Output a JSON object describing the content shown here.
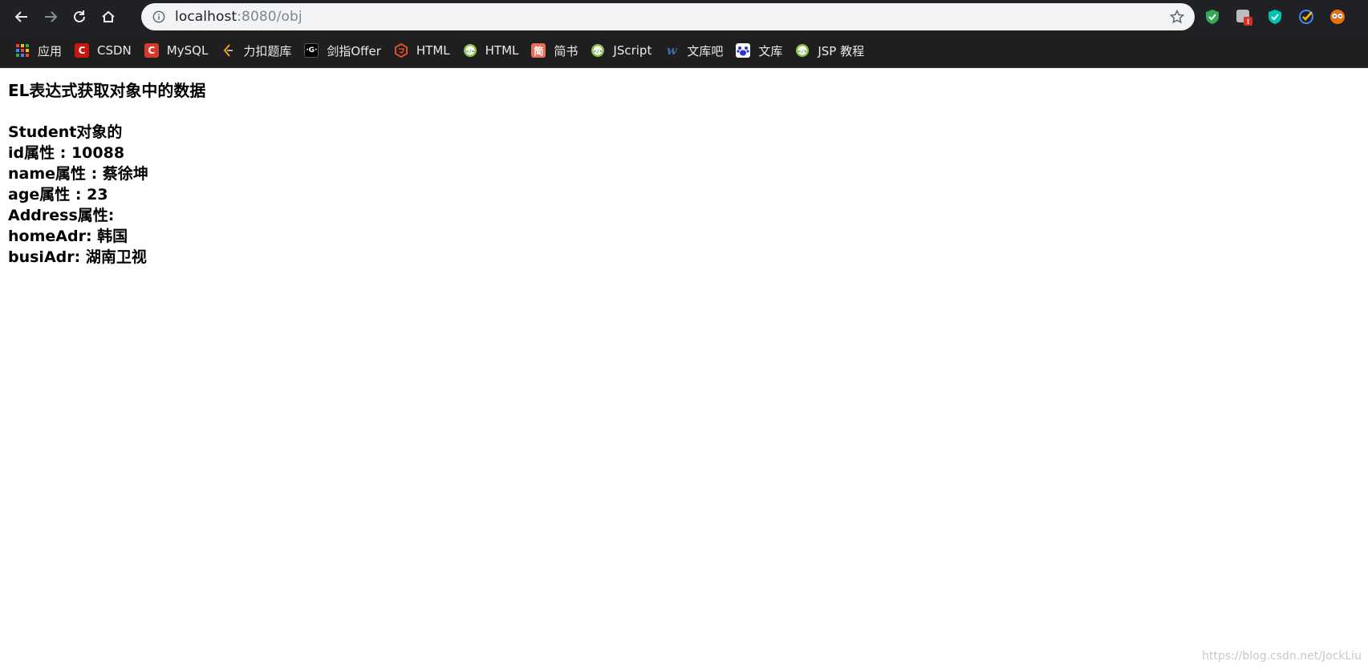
{
  "browser": {
    "url_host": "localhost",
    "url_path": ":8080/obj",
    "icons": {
      "back": "arrow-left-icon",
      "forward": "arrow-right-icon",
      "reload": "reload-icon",
      "home": "home-icon",
      "info": "info-icon",
      "star": "star-icon"
    },
    "extensions": [
      {
        "name": "shield-green-extension-icon",
        "color": "#34a853"
      },
      {
        "name": "badge-extension-icon",
        "badge": "!",
        "color": "#d93025"
      },
      {
        "name": "shield-cyan-extension-icon",
        "color": "#00c4b3"
      },
      {
        "name": "checkmark-extension-icon",
        "color": "#fbbc04"
      },
      {
        "name": "avatar-extension-icon",
        "color": "#e8710a"
      }
    ]
  },
  "bookmarks": [
    {
      "label": "应用",
      "icon": "apps-grid-icon",
      "color": "#ea4335"
    },
    {
      "label": "CSDN",
      "icon": "csdn-icon",
      "color": "#c9170e"
    },
    {
      "label": "MySQL",
      "icon": "csdn-icon",
      "color": "#d43b2c"
    },
    {
      "label": "力扣题库",
      "icon": "leetcode-icon",
      "color": "#f89f1b"
    },
    {
      "label": "剑指Offer",
      "icon": "nowcoder-icon",
      "color": "#000000"
    },
    {
      "label": "HTML",
      "icon": "html5-icon",
      "color": "#e34c26"
    },
    {
      "label": "HTML",
      "icon": "code-circle-icon",
      "color": "#8bc34a"
    },
    {
      "label": "简书",
      "icon": "jianshu-icon",
      "color": "#ea6f5a"
    },
    {
      "label": "JScript",
      "icon": "code-circle-icon",
      "color": "#8bc34a"
    },
    {
      "label": "文库吧",
      "icon": "wenkuba-icon",
      "color": "#3f6ea0"
    },
    {
      "label": "文库",
      "icon": "baidu-paw-icon",
      "color": "#2932e1"
    },
    {
      "label": "JSP 教程",
      "icon": "code-circle-icon",
      "color": "#8bc34a"
    }
  ],
  "page": {
    "heading": "EL表达式获取对象中的数据",
    "lines": [
      "Student对象的",
      "id属性 : 10088",
      "name属性 : 蔡徐坤",
      "age属性 : 23",
      "Address属性:",
      "homeAdr: 韩国",
      "busiAdr: 湖南卫视"
    ]
  },
  "watermark": "https://blog.csdn.net/JockLiu"
}
